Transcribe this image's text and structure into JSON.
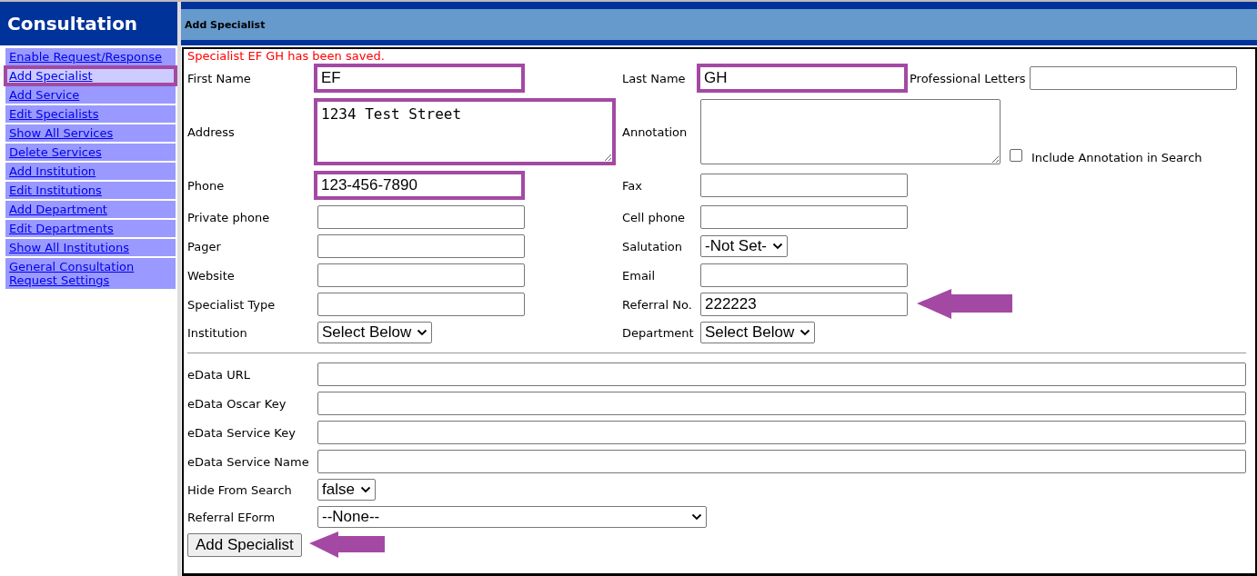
{
  "sidebar": {
    "title": "Consultation",
    "items": [
      {
        "label": "Enable Request/Response",
        "selected": false,
        "highlighted": false
      },
      {
        "label": "Add Specialist",
        "selected": true,
        "highlighted": true
      },
      {
        "label": "Add Service",
        "selected": false,
        "highlighted": false
      },
      {
        "label": "Edit Specialists",
        "selected": false,
        "highlighted": false
      },
      {
        "label": "Show All Services",
        "selected": false,
        "highlighted": false
      },
      {
        "label": "Delete Services",
        "selected": false,
        "highlighted": false
      },
      {
        "label": "Add Institution",
        "selected": false,
        "highlighted": false
      },
      {
        "label": "Edit Institutions",
        "selected": false,
        "highlighted": false
      },
      {
        "label": "Add Department",
        "selected": false,
        "highlighted": false
      },
      {
        "label": "Edit Departments",
        "selected": false,
        "highlighted": false
      },
      {
        "label": "Show All Institutions",
        "selected": false,
        "highlighted": false
      },
      {
        "label": "General Consultation Request Settings",
        "selected": false,
        "highlighted": false
      }
    ]
  },
  "panel_title": "Add Specialist",
  "message": "Specialist EF GH has been saved.",
  "rows": [
    {
      "cells": [
        {
          "kind": "text",
          "label": "First Name",
          "value": "EF",
          "highlighted": true,
          "arrow": false
        },
        {
          "kind": "text",
          "label": "Last Name",
          "value": "GH",
          "highlighted": true,
          "arrow": false
        },
        {
          "kind": "text",
          "label": "Professional Letters",
          "highlighted": false,
          "arrow": false
        }
      ]
    },
    {
      "cells": [
        {
          "kind": "textarea",
          "label": "Address",
          "value": "1234 Test Street",
          "highlighted": true,
          "arrow": false
        },
        {
          "kind": "textarea",
          "label": "Annotation",
          "highlighted": false,
          "arrow": false
        },
        {
          "kind": "checkbox",
          "label": "Include Annotation in Search",
          "checked": false
        }
      ]
    },
    {
      "cells": [
        {
          "kind": "text",
          "label": "Phone",
          "value": "123-456-7890",
          "highlighted": true,
          "arrow": false
        },
        {
          "kind": "text",
          "label": "Fax",
          "highlighted": false,
          "arrow": false
        }
      ]
    },
    {
      "cells": [
        {
          "kind": "text",
          "label": "Private phone",
          "highlighted": false,
          "arrow": false
        },
        {
          "kind": "text",
          "label": "Cell phone",
          "highlighted": false,
          "arrow": false
        }
      ]
    },
    {
      "cells": [
        {
          "kind": "text",
          "label": "Pager",
          "highlighted": false,
          "arrow": false
        },
        {
          "kind": "select",
          "label": "Salutation",
          "value": "-Not Set-",
          "highlighted": false,
          "arrow": false
        }
      ]
    },
    {
      "cells": [
        {
          "kind": "text",
          "label": "Website",
          "highlighted": false,
          "arrow": false
        },
        {
          "kind": "text",
          "label": "Email",
          "highlighted": false,
          "arrow": false
        }
      ]
    },
    {
      "cells": [
        {
          "kind": "text",
          "label": "Specialist Type",
          "highlighted": false,
          "arrow": false
        },
        {
          "kind": "text",
          "label": "Referral No.",
          "value": "222223",
          "highlighted": false,
          "arrow": true
        }
      ]
    },
    {
      "cells": [
        {
          "kind": "select",
          "label": "Institution",
          "value": "Select Below",
          "highlighted": false,
          "arrow": false
        },
        {
          "kind": "select",
          "label": "Department",
          "value": "Select Below",
          "highlighted": false,
          "arrow": false
        }
      ]
    }
  ],
  "wide_fields": [
    {
      "kind": "text",
      "label": "eData URL"
    },
    {
      "kind": "text",
      "label": "eData Oscar Key"
    },
    {
      "kind": "text",
      "label": "eData Service Key"
    },
    {
      "kind": "text",
      "label": "eData Service Name"
    },
    {
      "kind": "select",
      "label": "Hide From Search",
      "value": "false"
    },
    {
      "kind": "select",
      "label": "Referral EForm",
      "value": "--None--",
      "wide": true
    }
  ],
  "submit": {
    "label": "Add Specialist",
    "arrow": true
  }
}
